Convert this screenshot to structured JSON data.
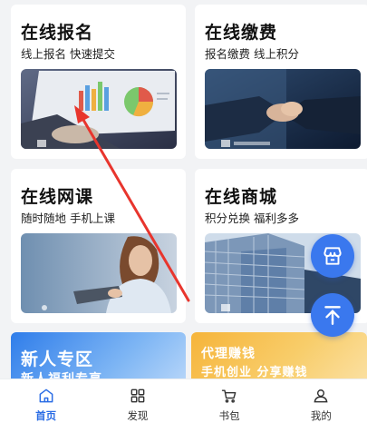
{
  "cards": [
    {
      "title": "在线报名",
      "subtitle": "线上报名 快速提交",
      "image": "laptop-chart-photo"
    },
    {
      "title": "在线缴费",
      "subtitle": "报名缴费 线上积分",
      "image": "handshake-photo"
    },
    {
      "title": "在线网课",
      "subtitle": "随时随地 手机上课",
      "image": "woman-tablet-photo"
    },
    {
      "title": "在线商城",
      "subtitle": "积分兑换 福利多多",
      "image": "building-photo"
    }
  ],
  "banners": [
    {
      "title": "新人专区",
      "subtitle": "新人福利专享"
    },
    {
      "title": "代理赚钱",
      "subtitle": "手机创业 分享赚钱"
    }
  ],
  "tabbar": [
    {
      "label": "首页",
      "icon": "home-icon",
      "active": true
    },
    {
      "label": "发现",
      "icon": "grid-icon",
      "active": false
    },
    {
      "label": "书包",
      "icon": "cart-icon",
      "active": false
    },
    {
      "label": "我的",
      "icon": "user-icon",
      "active": false
    }
  ],
  "fabs": {
    "shop": "store-icon",
    "top": "back-to-top-icon"
  },
  "colors": {
    "accent": "#3a78ee",
    "active_tab": "#2b6de5",
    "annotation_arrow": "#e8352d"
  }
}
